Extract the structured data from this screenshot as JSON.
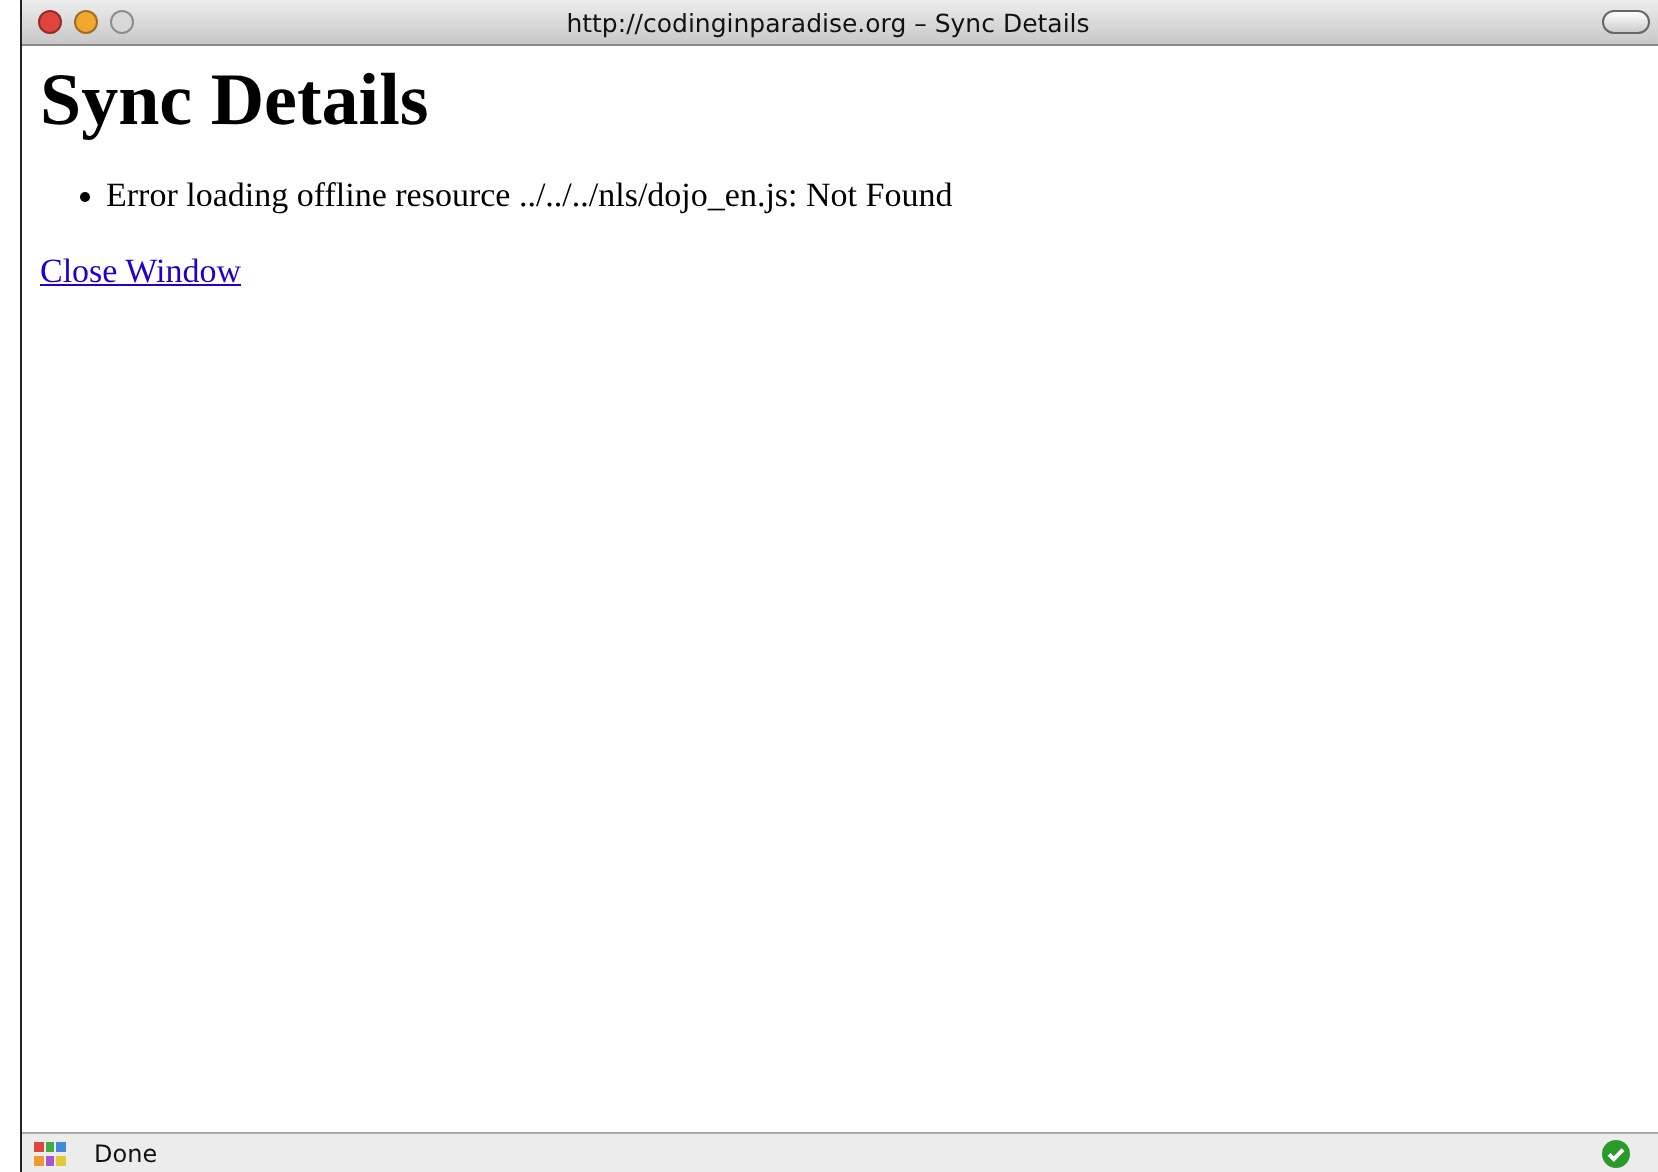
{
  "window": {
    "title": "http://codinginparadise.org – Sync Details"
  },
  "page": {
    "heading": "Sync Details",
    "errors": [
      "Error loading offline resource ../../../nls/dojo_en.js: Not Found"
    ],
    "link": "Close Window"
  },
  "status_bar": {
    "text": "Done",
    "secure": true
  }
}
